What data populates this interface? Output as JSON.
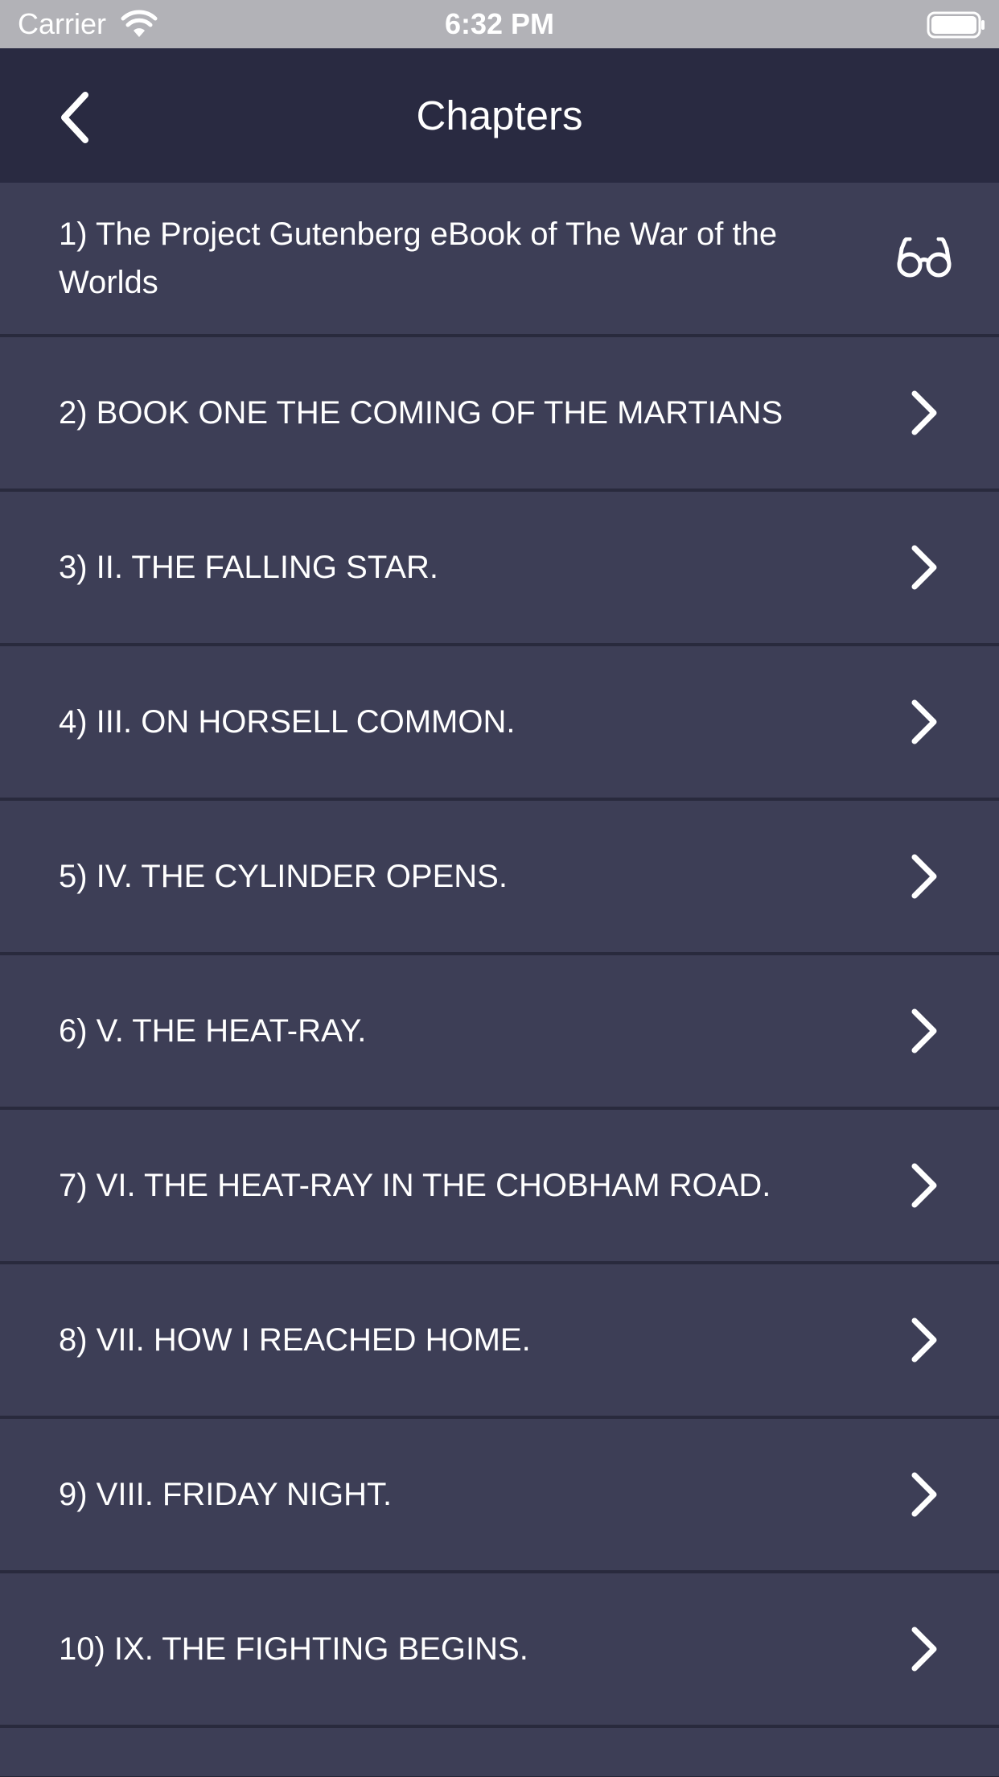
{
  "status_bar": {
    "carrier": "Carrier",
    "time": "6:32 PM"
  },
  "nav": {
    "title": "Chapters",
    "back_icon": "chevron-left-icon"
  },
  "chapters": [
    {
      "label": "1) The Project Gutenberg eBook of The War of the Worlds",
      "icon": "glasses-icon",
      "current": true
    },
    {
      "label": "2) BOOK ONE THE COMING OF THE MARTIANS",
      "icon": "chevron-right-icon"
    },
    {
      "label": "3) II. THE FALLING STAR.",
      "icon": "chevron-right-icon"
    },
    {
      "label": "4) III. ON HORSELL COMMON.",
      "icon": "chevron-right-icon"
    },
    {
      "label": "5) IV. THE CYLINDER OPENS.",
      "icon": "chevron-right-icon"
    },
    {
      "label": "6) V. THE HEAT-RAY.",
      "icon": "chevron-right-icon"
    },
    {
      "label": "7) VI. THE HEAT-RAY IN THE CHOBHAM ROAD.",
      "icon": "chevron-right-icon"
    },
    {
      "label": "8) VII. HOW I REACHED HOME.",
      "icon": "chevron-right-icon"
    },
    {
      "label": "9) VIII. FRIDAY NIGHT.",
      "icon": "chevron-right-icon"
    },
    {
      "label": "10) IX. THE FIGHTING BEGINS.",
      "icon": "chevron-right-icon"
    }
  ],
  "colors": {
    "status_bar": "#b2b2b7",
    "nav_bar": "#292a41",
    "row": "#3d3e56",
    "separator": "#292a3d",
    "text": "#ffffff"
  }
}
